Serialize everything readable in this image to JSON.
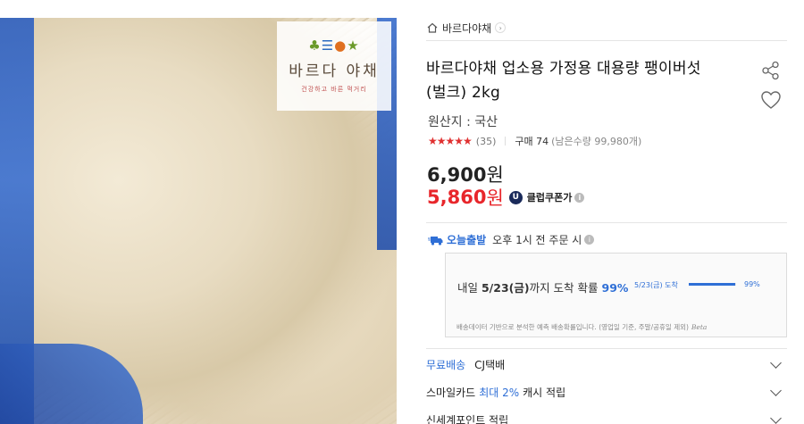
{
  "image": {
    "alt": "",
    "brand_logo": {
      "mark": "",
      "name": "바르다 야채",
      "slogan": "건강하고 바른 먹거리"
    }
  },
  "store": {
    "name": "바르다야채",
    "icon": "home-icon"
  },
  "product": {
    "title_line1": "바르다야채 업소용 가정용 대용량 팽이버섯",
    "title_line2": "(벌크) 2kg",
    "origin": "원산지 : 국산"
  },
  "rating": {
    "stars": "★★★★★",
    "score": 4.5,
    "count": "(35)",
    "purchase": "구매 74",
    "remaining": "(남은수량 99,980개)"
  },
  "price": {
    "original": "6,900",
    "original_unit": "원",
    "sale": "5,860",
    "sale_unit": "원",
    "coupon_badge": "U",
    "coupon_label": "클럽쿠폰가"
  },
  "shipping": {
    "today_label": "오늘출발",
    "cutoff": "오후 1시 전 주문 시",
    "box": {
      "prefix": "내일 ",
      "date": "5/23(금)",
      "middle": "까지 도착 확률 ",
      "percent": "99%",
      "chart_label": "5/23(금) 도착",
      "chart_percent": "99%",
      "chart_value": 0.99,
      "note": "배송데이터 기반으로 분석한 예측 배송확률입니다. (영업일 기준, 주말/공휴일 제외)",
      "beta": "Beta"
    }
  },
  "accordion": {
    "shipping_free": "무료배송",
    "shipping_carrier": "CJ택배",
    "smilecard_prefix": "스마일카드",
    "smilecard_max": "최대 2%",
    "smilecard_suffix": "캐시 적립",
    "partial_row": "신세계포인트 적립"
  },
  "colors": {
    "accent_blue": "#2f6fd6",
    "sale_red": "#e8262b",
    "star_red": "#e03030"
  }
}
